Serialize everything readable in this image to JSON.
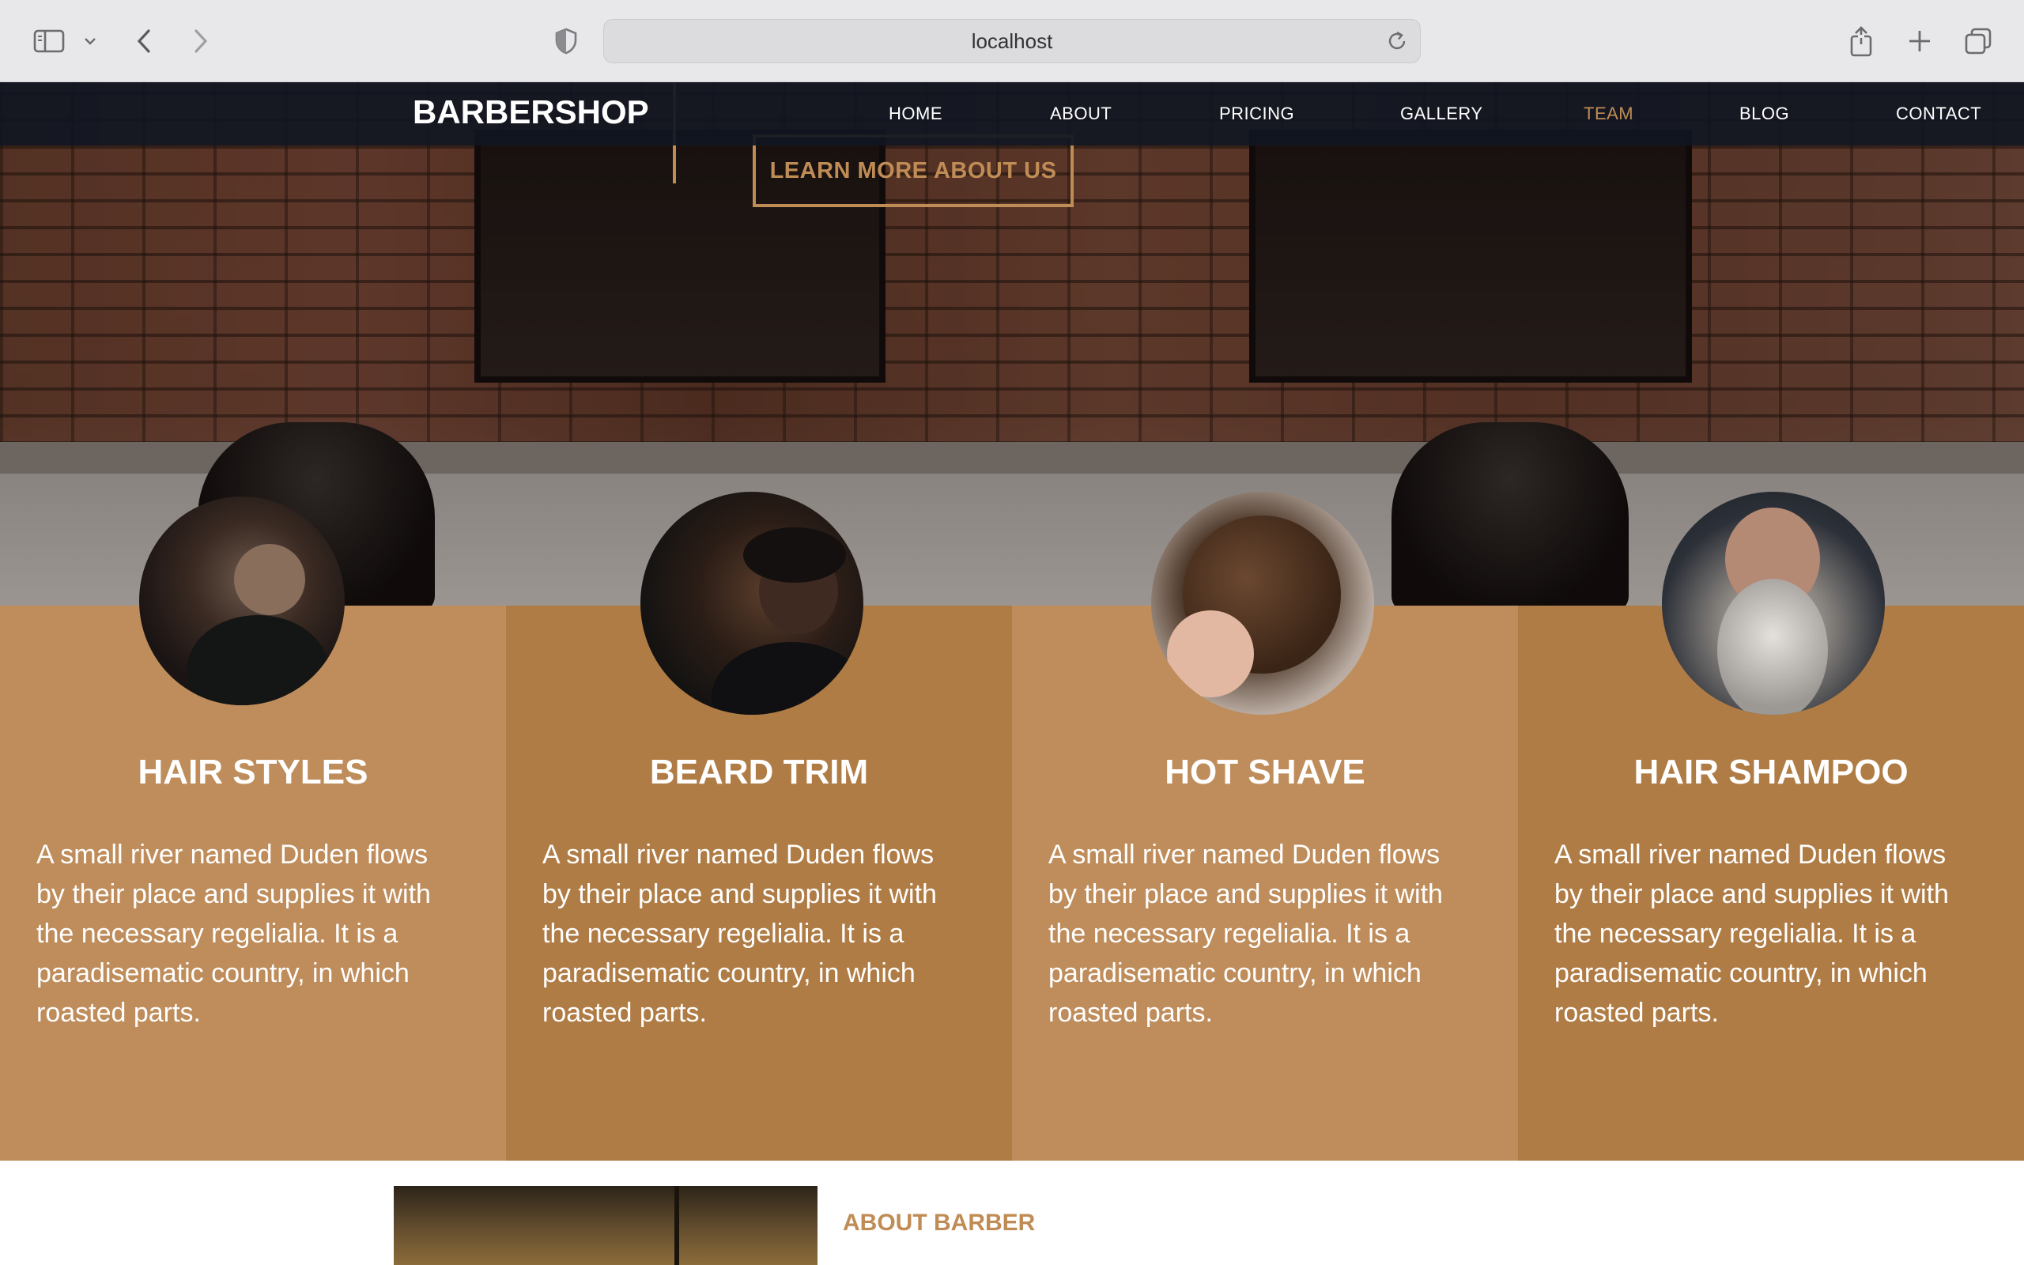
{
  "browser": {
    "url": "localhost"
  },
  "nav": {
    "brand": "BARBERSHOP",
    "items": [
      {
        "label": "HOME",
        "active": false
      },
      {
        "label": "ABOUT",
        "active": false
      },
      {
        "label": "PRICING",
        "active": false
      },
      {
        "label": "GALLERY",
        "active": false
      },
      {
        "label": "TEAM",
        "active": true
      },
      {
        "label": "BLOG",
        "active": false
      },
      {
        "label": "CONTACT",
        "active": false
      }
    ]
  },
  "hero": {
    "cta_label": "LEARN MORE ABOUT US"
  },
  "services": [
    {
      "title": "HAIR STYLES",
      "text": "A small river named Duden flows by their place and supplies it with the necessary regelialia. It is a paradisematic country, in which roasted parts."
    },
    {
      "title": "BEARD TRIM",
      "text": "A small river named Duden flows by their place and supplies it with the necessary regelialia. It is a paradisematic country, in which roasted parts."
    },
    {
      "title": "HOT SHAVE",
      "text": "A small river named Duden flows by their place and supplies it with the necessary regelialia. It is a paradisematic country, in which roasted parts."
    },
    {
      "title": "HAIR SHAMPOO",
      "text": "A small river named Duden flows by their place and supplies it with the necessary regelialia. It is a paradisematic country, in which roasted parts."
    }
  ],
  "about": {
    "label": "ABOUT BARBER"
  },
  "colors": {
    "accent": "#c08c55",
    "nav_bg": "#101622",
    "service_light": "#bf8d5b",
    "service_dark": "#b07c45"
  }
}
